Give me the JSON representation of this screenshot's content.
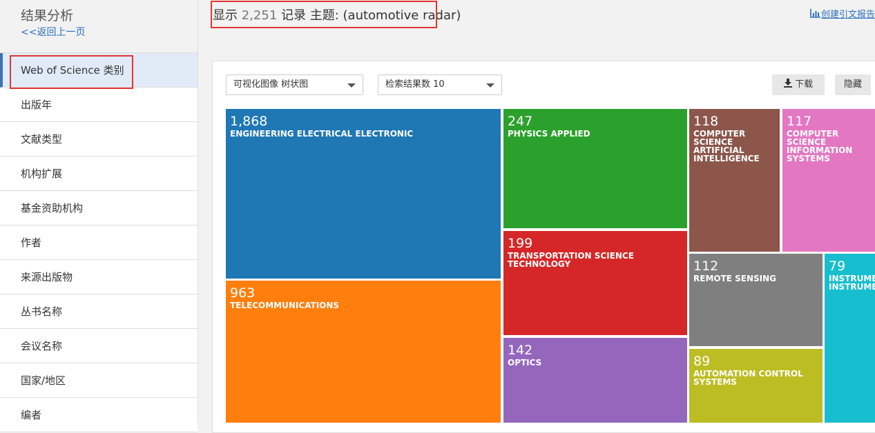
{
  "sidebar": {
    "title": "结果分析",
    "back_link": "<<返回上一页",
    "items": [
      {
        "label": "Web of Science 类别",
        "active": true
      },
      {
        "label": "出版年"
      },
      {
        "label": "文献类型"
      },
      {
        "label": "机构扩展"
      },
      {
        "label": "基金资助机构"
      },
      {
        "label": "作者"
      },
      {
        "label": "来源出版物"
      },
      {
        "label": "丛书名称"
      },
      {
        "label": "会议名称"
      },
      {
        "label": "国家/地区"
      },
      {
        "label": "编者"
      }
    ]
  },
  "header": {
    "show_label": "显示",
    "record_count": "2,251",
    "records_label": "记录",
    "topic_label": "主题: (automotive radar)",
    "cite_link": "创建引文报告"
  },
  "controls": {
    "viz_select": "可视化图像 树状图",
    "results_select": "检索结果数 10",
    "download_button": "下载",
    "hide_button": "隐藏"
  },
  "icons": {
    "chart": "bar-chart-icon",
    "download": "download-icon",
    "caret": "chevron-down-icon"
  },
  "highlight_color": "#e53333",
  "chart_data": {
    "type": "treemap",
    "items": [
      {
        "value": "1,868",
        "label": "ENGINEERING ELECTRICAL ELECTRONIC",
        "color": "#1f77b4"
      },
      {
        "value": "963",
        "label": "TELECOMMUNICATIONS",
        "color": "#ff7f0e"
      },
      {
        "value": "247",
        "label": "PHYSICS APPLIED",
        "color": "#2ca02c"
      },
      {
        "value": "199",
        "label": "TRANSPORTATION SCIENCE TECHNOLOGY",
        "color": "#d62728"
      },
      {
        "value": "142",
        "label": "OPTICS",
        "color": "#9467bd"
      },
      {
        "value": "118",
        "label": "COMPUTER SCIENCE ARTIFICIAL INTELLIGENCE",
        "color": "#8c564b"
      },
      {
        "value": "117",
        "label": "COMPUTER SCIENCE INFORMATION SYSTEMS",
        "color": "#e377c2"
      },
      {
        "value": "112",
        "label": "REMOTE SENSING",
        "color": "#7f7f7f"
      },
      {
        "value": "89",
        "label": "AUTOMATION CONTROL SYSTEMS",
        "color": "#bcbd22"
      },
      {
        "value": "79",
        "label": "INSTRUMENTS INSTRUMENTATION",
        "color": "#17becf"
      }
    ]
  }
}
